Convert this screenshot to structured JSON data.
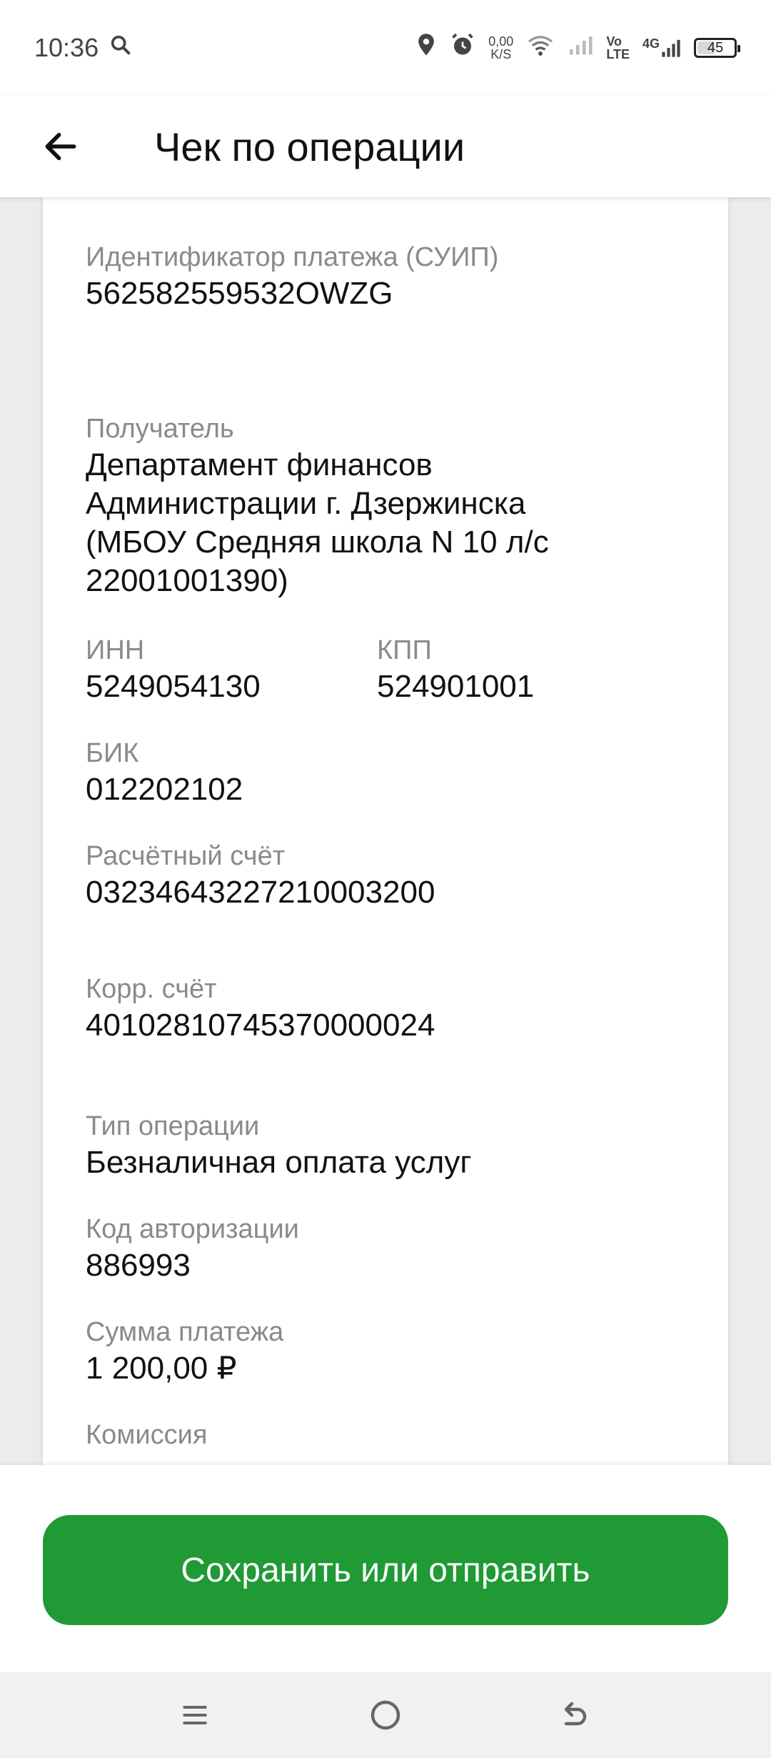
{
  "status": {
    "time": "10:36",
    "net_speed_value": "0,00",
    "net_speed_unit": "K/S",
    "volte_top": "Vo",
    "volte_bottom": "LTE",
    "network_type": "4G",
    "battery": "45",
    "battery_level": 0.45
  },
  "header": {
    "title": "Чек по операции",
    "back_icon": "arrow-left-icon"
  },
  "receipt": {
    "suip_label": "Идентификатор платежа (СУИП)",
    "suip_value": "562582559532OWZG",
    "recipient_label": "Получатель",
    "recipient_value": "Департамент финансов Администрации г. Дзержинска (МБОУ  Средняя школа N 10 л/с 22001001390)",
    "inn_label": "ИНН",
    "inn_value": "5249054130",
    "kpp_label": "КПП",
    "kpp_value": "524901001",
    "bik_label": "БИК",
    "bik_value": "012202102",
    "account_label": "Расчётный счёт",
    "account_value": "03234643227210003200",
    "corr_label": "Корр. счёт",
    "corr_value": "40102810745370000024",
    "op_type_label": "Тип операции",
    "op_type_value": "Безналичная оплата услуг",
    "auth_label": "Код авторизации",
    "auth_value": "886993",
    "amount_label": "Сумма платежа",
    "amount_value": "1 200,00 ₽",
    "commission_label": "Комиссия"
  },
  "actions": {
    "save_label": "Сохранить или отправить",
    "accent": "#1f9a35"
  },
  "nav": {
    "menu_icon": "menu-icon",
    "home_icon": "home-circle-icon",
    "back_icon": "back-arrow-icon"
  }
}
